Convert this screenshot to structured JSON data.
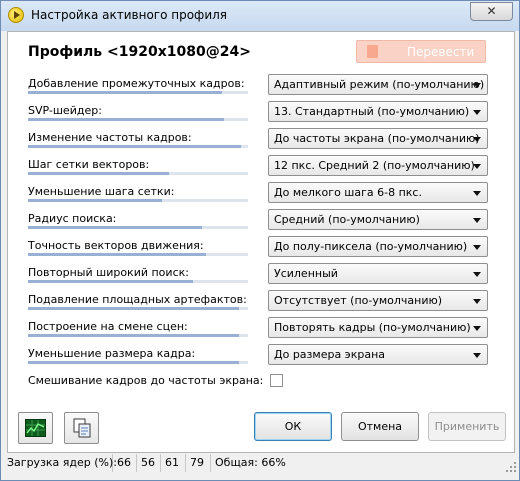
{
  "window": {
    "title": "Настройка активного профиля",
    "close_label": "✕"
  },
  "header": {
    "profile_title": "Профиль <1920x1080@24>",
    "translate_label": "Перевести"
  },
  "settings": [
    {
      "label": "Добавление промежуточных кадров:",
      "value": "Адаптивный режим (по-умолчанию)",
      "level": 0.88
    },
    {
      "label": "SVP-шейдер:",
      "value": "13. Стандартный (по-умолчанию)",
      "level": 0.89
    },
    {
      "label": "Изменение частоты кадров:",
      "value": "До частоты экрана (по-умолчанию)",
      "level": 0.97
    },
    {
      "label": "Шаг сетки векторов:",
      "value": "12 пкс. Средний 2 (по-умолчанию)",
      "level": 0.64
    },
    {
      "label": "Уменьшение шага сетки:",
      "value": "До мелкого шага 6-8 пкс.",
      "level": 0.61
    },
    {
      "label": "Радиус поиска:",
      "value": "Средний (по-умолчанию)",
      "level": 0.79
    },
    {
      "label": "Точность векторов движения:",
      "value": "До полу-пиксела (по-умолчанию)",
      "level": 0.81
    },
    {
      "label": "Повторный широкий поиск:",
      "value": "Усиленный",
      "level": 0.75
    },
    {
      "label": "Подавление площадных артефактов:",
      "value": "Отсутствует (по-умолчанию)",
      "level": 0.96
    },
    {
      "label": "Построение на смене сцен:",
      "value": "Повторять кадры (по-умолчанию)",
      "level": 0.96
    },
    {
      "label": "Уменьшение размера кадра:",
      "value": "До размера экрана",
      "level": 0.96
    }
  ],
  "blend": {
    "label": "Смешивание кадров до частоты экрана:",
    "checked": false
  },
  "buttons": {
    "ok": "ОК",
    "cancel": "Отмена",
    "apply": "Применить"
  },
  "icons": {
    "graph": "graph-icon",
    "copy": "copy-profile-icon"
  },
  "status": {
    "label": "Загрузка ядер (%):",
    "cores": [
      "66",
      "56",
      "61",
      "79"
    ],
    "total": "Общая: 66%"
  },
  "colors": {
    "accent": "#99b0d5",
    "translate_button": "#fbd2c6"
  }
}
